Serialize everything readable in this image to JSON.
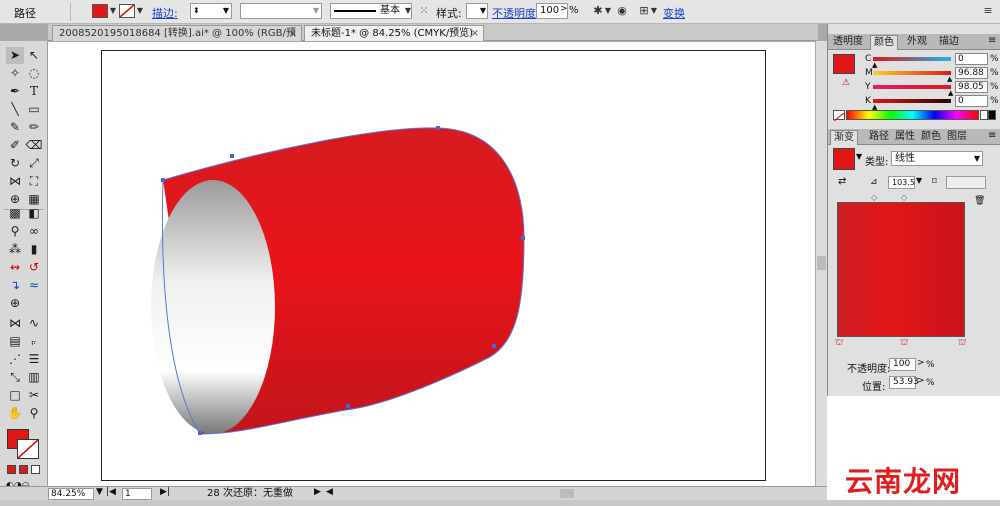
{
  "control_bar": {
    "object_type": "路径",
    "stroke_label": "描边:",
    "stroke_style": "基本",
    "style_label": "样式:",
    "opacity_label": "不透明度:",
    "opacity_value": "100",
    "opacity_unit": "%",
    "transform_label": "变换",
    "fill_color": "#e01818"
  },
  "tabs": [
    {
      "label": "2008520195018684 [转换].ai* @ 100% (RGB/预览)",
      "close": "×"
    },
    {
      "label": "未标题-1* @ 84.25% (CMYK/预览)",
      "close": "×"
    }
  ],
  "status_bar": {
    "zoom": "84.25%",
    "page": "1",
    "history": "28 次还原：无重做"
  },
  "color_panel": {
    "tabs": [
      "透明度",
      "颜色",
      "外观",
      "描边"
    ],
    "active_tab": "颜色",
    "channels": [
      {
        "label": "C",
        "value": "0",
        "unit": "%"
      },
      {
        "label": "M",
        "value": "96.88",
        "unit": "%"
      },
      {
        "label": "Y",
        "value": "98.05",
        "unit": "%"
      },
      {
        "label": "K",
        "value": "0",
        "unit": "%"
      }
    ],
    "channel_levels": [
      0,
      0.9688,
      0.9805,
      0
    ],
    "swatch_color": "#e01818"
  },
  "gradient_panel": {
    "tabs": [
      "渐变",
      "路径",
      "属性",
      "颜色",
      "图层"
    ],
    "active_tab": "渐变",
    "type_label": "类型:",
    "type_value": "线性",
    "angle_value": "103.5",
    "opacity_label": "不透明度:",
    "opacity_value": "100",
    "position_label": "位置:",
    "position_value": "53.93",
    "unit": "%"
  },
  "watermark": "云南龙网"
}
